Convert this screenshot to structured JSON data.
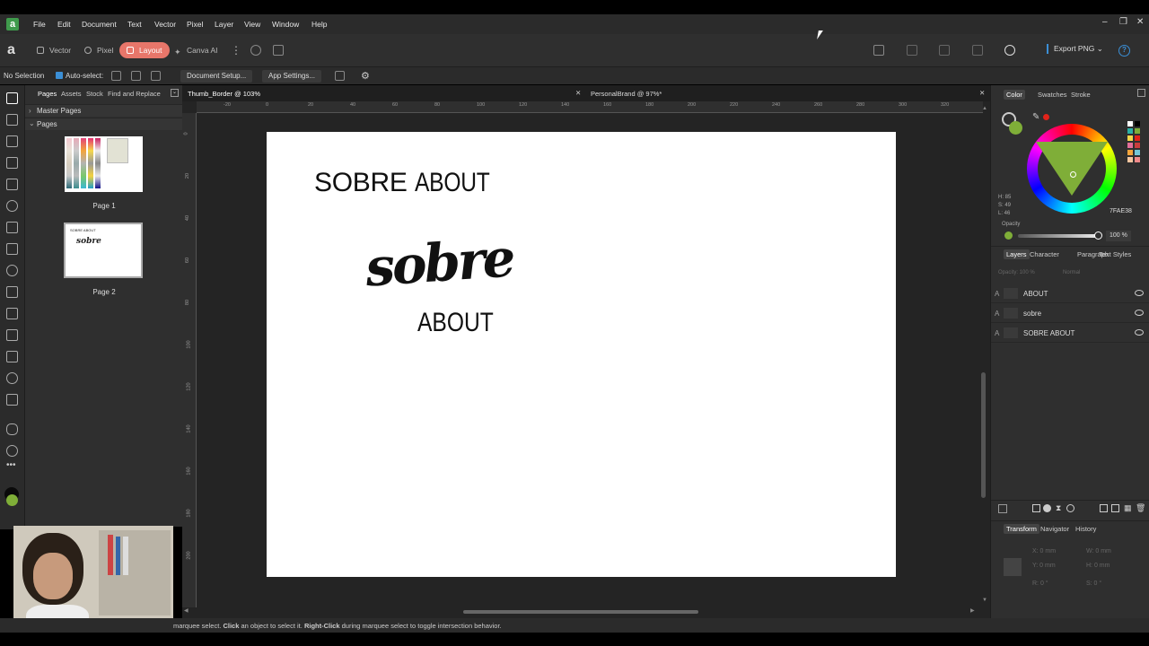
{
  "menu": [
    "File",
    "Edit",
    "Document",
    "Text",
    "Vector",
    "Pixel",
    "Layer",
    "View",
    "Window",
    "Help"
  ],
  "personas": {
    "vector": "Vector",
    "pixel": "Pixel",
    "layout": "Layout",
    "canva": "Canva AI"
  },
  "export_label": "Export PNG",
  "context": {
    "selection": "No Selection",
    "autoselect": "Auto-select:",
    "doc_setup": "Document Setup...",
    "app_settings": "App Settings..."
  },
  "pages_panel": {
    "tabs": [
      "Pages",
      "Assets",
      "Stock",
      "Find and Replace"
    ],
    "master": "Master Pages",
    "pages": "Pages",
    "page1": "Page 1",
    "page2": "Page 2"
  },
  "doc_tabs": [
    "Thumb_Border @ 103%",
    "PersonalBrand @ 97%*"
  ],
  "ruler_h": [
    "-20",
    "0",
    "20",
    "40",
    "60",
    "80",
    "100",
    "120",
    "140",
    "160",
    "180",
    "200",
    "220",
    "240",
    "260",
    "280",
    "300",
    "320"
  ],
  "ruler_v": [
    "0",
    "20",
    "40",
    "60",
    "80",
    "100",
    "120",
    "140",
    "160",
    "180",
    "200"
  ],
  "canvas": {
    "title_bold": "SOBRE",
    "title_thin": "ABOUT",
    "script": "sobre",
    "sub": "ABOUT"
  },
  "status": {
    "pre": "marquee select. ",
    "click": "Click",
    "mid": " an object to select it. ",
    "right": "Right-Click",
    "post": " during marquee select to toggle intersection behavior."
  },
  "color_panel": {
    "tabs": [
      "Color",
      "Swatches",
      "Stroke"
    ],
    "h": "H: 85",
    "s": "S: 49",
    "l": "L: 46",
    "hex": "7FAE38",
    "opacity_label": "Opacity",
    "opacity": "100 %",
    "accent": "#7fae38"
  },
  "layers_panel": {
    "tabs": [
      "Layers",
      "Character",
      "Paragraph",
      "Text Styles"
    ],
    "opacity": "Opacity: 100 %",
    "blend": "Normal",
    "layers": [
      {
        "type": "A",
        "name": "ABOUT"
      },
      {
        "type": "A",
        "name": "sobre"
      },
      {
        "type": "A",
        "name": "SOBRE ABOUT"
      }
    ]
  },
  "transform_panel": {
    "tabs": [
      "Transform",
      "Navigator",
      "History"
    ],
    "x": "X:   0 mm",
    "y": "Y:   0 mm",
    "w": "W:   0 mm",
    "h": "H:   0 mm",
    "r": "R:   0 °",
    "s": "S:   0 °"
  }
}
